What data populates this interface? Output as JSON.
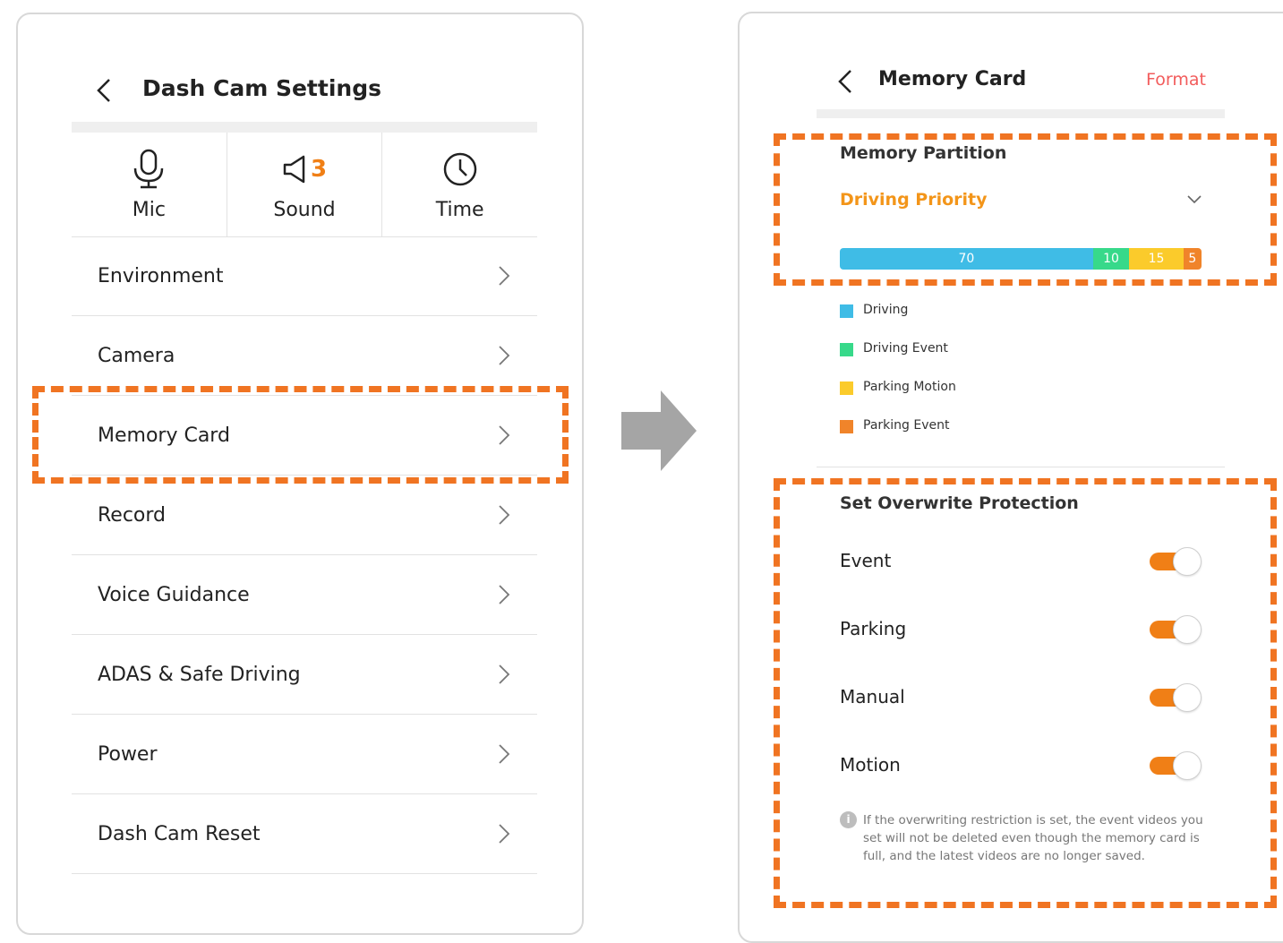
{
  "left_screen": {
    "title": "Dash Cam Settings",
    "quick": {
      "mic": {
        "label": "Mic",
        "icon": "mic-icon"
      },
      "sound": {
        "label": "Sound",
        "icon": "speaker-icon",
        "count": "3"
      },
      "time": {
        "label": "Time",
        "icon": "clock-icon"
      }
    },
    "menu": [
      {
        "label": "Environment"
      },
      {
        "label": "Camera"
      },
      {
        "label": "Memory Card"
      },
      {
        "label": "Record"
      },
      {
        "label": "Voice Guidance"
      },
      {
        "label": "ADAS & Safe Driving"
      },
      {
        "label": "Power"
      },
      {
        "label": "Dash Cam Reset"
      }
    ]
  },
  "right_screen": {
    "title": "Memory Card",
    "format_label": "Format",
    "partition": {
      "title": "Memory Partition",
      "selected": "Driving Priority",
      "segments": [
        {
          "name": "Driving",
          "value": 70,
          "color": "#3fbce6"
        },
        {
          "name": "Driving Event",
          "value": 10,
          "color": "#37d98a"
        },
        {
          "name": "Parking Motion",
          "value": 15,
          "color": "#fbcb2b"
        },
        {
          "name": "Parking Event",
          "value": 5,
          "color": "#f0842a"
        }
      ]
    },
    "overwrite": {
      "title": "Set Overwrite Protection",
      "toggles": [
        {
          "label": "Event",
          "on": true
        },
        {
          "label": "Parking",
          "on": true
        },
        {
          "label": "Manual",
          "on": true
        },
        {
          "label": "Motion",
          "on": true
        }
      ],
      "info": "If the overwriting restriction is set, the event videos you set will not be deleted even though the memory card is full, and the latest videos are no longer saved."
    }
  },
  "colors": {
    "accent": "#f07f16",
    "highlight_dash": "#f07422",
    "format": "#f25c5c",
    "priority": "#f39519",
    "arrow": "#a5a5a5"
  }
}
